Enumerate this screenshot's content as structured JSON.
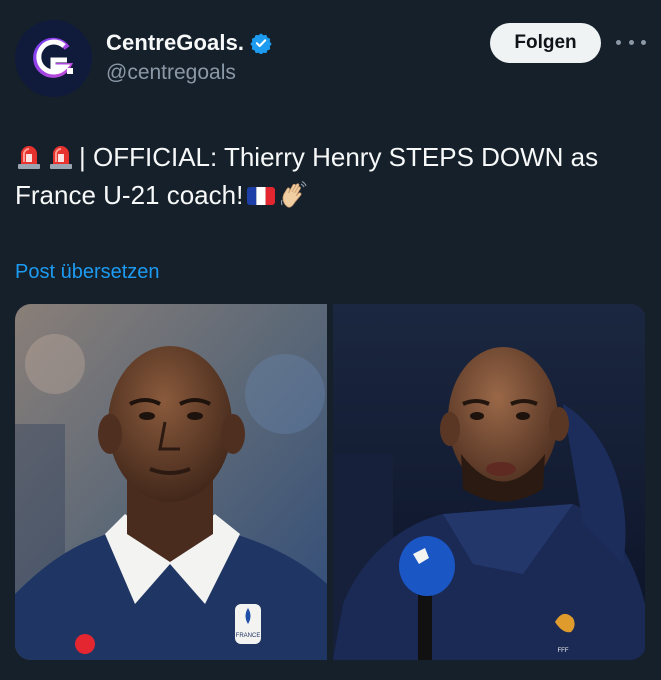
{
  "author": {
    "name": "CentreGoals.",
    "handle": "@centregoals",
    "avatar_letter": "G.",
    "verified": true,
    "brand_color": "#101a3a"
  },
  "actions": {
    "follow_label": "Folgen",
    "more_icon": "more-horizontal-icon"
  },
  "tweet": {
    "emoji_prefix": [
      "police-light-icon",
      "police-light-icon"
    ],
    "text_line": "| OFFICIAL: Thierry Henry STEPS DOWN as France U-21 coach!",
    "emoji_suffix": [
      "france-flag-icon",
      "waving-hand-icon"
    ],
    "translate_label": "Post übersetzen"
  },
  "media": {
    "photos": [
      {
        "subject": "portrait-in-france-shirt",
        "badge_text": "FRANCE"
      },
      {
        "subject": "interview-with-microphone",
        "badge_text": "FFF"
      }
    ]
  },
  "colors": {
    "background": "#15202b",
    "text": "#f7f9f9",
    "secondary_text": "#8b98a5",
    "link": "#1d9bf0",
    "verified": "#1d9bf0"
  }
}
